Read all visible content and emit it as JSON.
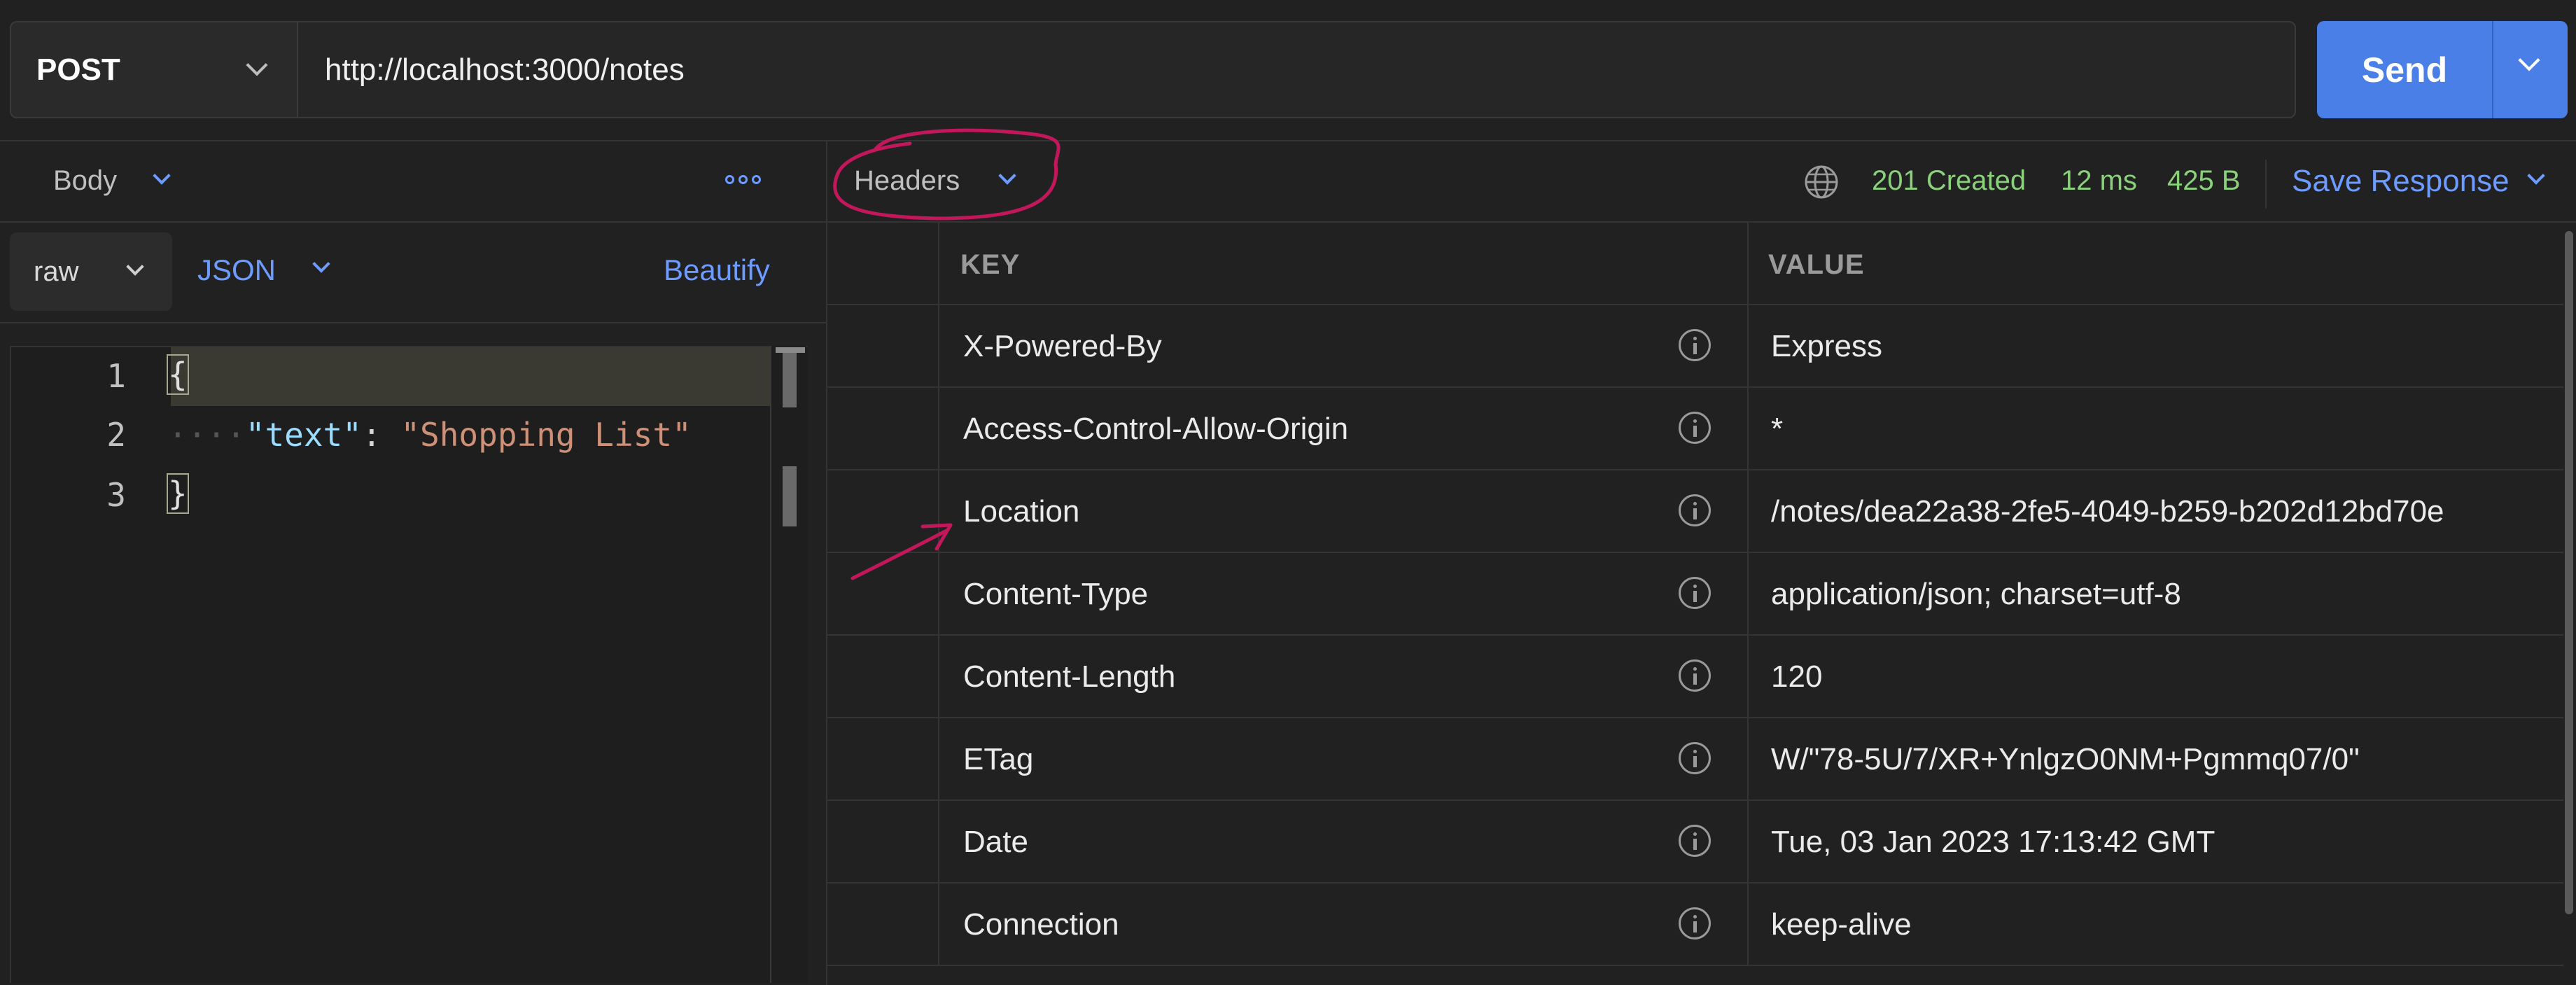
{
  "request": {
    "method": "POST",
    "url": "http://localhost:3000/notes",
    "send_label": "Send"
  },
  "body_pane": {
    "tab_label": "Body",
    "format_select": "raw",
    "language_select": "JSON",
    "beautify_label": "Beautify",
    "lines": [
      {
        "num": "1",
        "code": "{"
      },
      {
        "num": "2",
        "key": "\"text\"",
        "colon": ": ",
        "value": "\"Shopping List\""
      },
      {
        "num": "3",
        "code": "}"
      }
    ]
  },
  "response_pane": {
    "tab_label": "Headers",
    "status": "201 Created",
    "time": "12 ms",
    "size": "425 B",
    "save_label": "Save Response",
    "columns": [
      "KEY",
      "VALUE"
    ],
    "headers": [
      {
        "key": "X-Powered-By",
        "value": "Express"
      },
      {
        "key": "Access-Control-Allow-Origin",
        "value": "*"
      },
      {
        "key": "Location",
        "value": "/notes/dea22a38-2fe5-4049-b259-b202d12bd70e"
      },
      {
        "key": "Content-Type",
        "value": "application/json; charset=utf-8"
      },
      {
        "key": "Content-Length",
        "value": "120"
      },
      {
        "key": "ETag",
        "value": "W/\"78-5U/7/XR+YnlgzO0NM+Pgmmq07/0\""
      },
      {
        "key": "Date",
        "value": "Tue, 03 Jan 2023 17:13:42 GMT"
      },
      {
        "key": "Connection",
        "value": "keep-alive"
      }
    ]
  },
  "colors": {
    "accent": "#4a7fe8",
    "link": "#6d9bff",
    "success": "#8bd17c",
    "annotation": "#c2185b"
  },
  "icons": [
    "chevron-down-icon",
    "more-icon",
    "globe-icon",
    "info-icon"
  ]
}
